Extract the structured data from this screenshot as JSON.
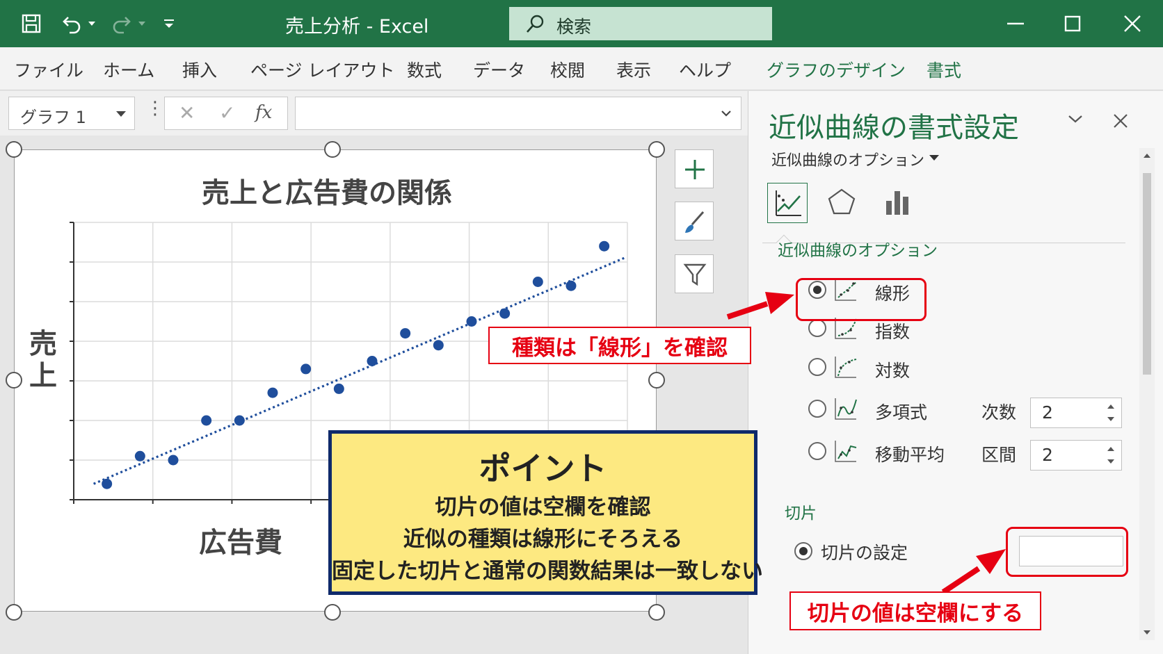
{
  "titlebar": {
    "title": "売上分析 - Excel",
    "search_label": "検索",
    "accent_color": "#217346"
  },
  "ribbon": {
    "tabs": [
      "ファイル",
      "ホーム",
      "挿入",
      "ページ レイアウト",
      "数式",
      "データ",
      "校閲",
      "表示",
      "ヘルプ",
      "グラフのデザイン",
      "書式"
    ]
  },
  "formula_bar": {
    "name_box": "グラフ 1",
    "fx_label": "fx",
    "cancel_symbol": "✕",
    "enter_symbol": "✓",
    "dots": "⋮"
  },
  "chart": {
    "title": "売上と広告費の関係",
    "ylabel_chars": [
      "売",
      "上"
    ],
    "xlabel": "広告費"
  },
  "chart_data": {
    "type": "scatter",
    "title": "売上と広告費の関係",
    "xlabel": "広告費",
    "ylabel": "売上",
    "x": [
      1,
      2,
      3,
      4,
      5,
      6,
      7,
      8,
      9,
      10,
      11,
      12,
      13,
      14,
      15,
      16
    ],
    "y": [
      0.4,
      1.1,
      1.0,
      2.0,
      2.0,
      2.7,
      3.3,
      2.8,
      3.5,
      4.2,
      3.9,
      4.5,
      4.7,
      5.5,
      5.4,
      6.4
    ],
    "trendline": {
      "type": "linear",
      "style": "dotted",
      "x": [
        0.6,
        16.6
      ],
      "y": [
        0.4,
        6.1
      ]
    },
    "xlim": [
      0,
      16.7
    ],
    "ylim": [
      0,
      7
    ],
    "grid": true,
    "marker_color": "#1f4e9c"
  },
  "pane": {
    "title": "近似曲線の書式設定",
    "subtitle": "近似曲線のオプション",
    "section_options": "近似曲線のオプション",
    "options": [
      {
        "label": "線形",
        "checked": true
      },
      {
        "label": "指数",
        "checked": false
      },
      {
        "label": "対数",
        "checked": false
      },
      {
        "label": "多項式",
        "checked": false
      },
      {
        "label": "移動平均",
        "checked": false
      }
    ],
    "order_label": "次数",
    "order_value": "2",
    "period_label": "区間",
    "period_value": "2",
    "section_intercept": "切片",
    "intercept_label": "切片の設定",
    "intercept_value": ""
  },
  "annotations": {
    "linear_callout": "種類は「線形」を確認",
    "intercept_callout": "切片の値は空欄にする",
    "callout_color": "#e60012",
    "point_title": "ポイント",
    "point_lines": [
      "切片の値は空欄を確認",
      "近似の種類は線形にそろえる",
      "固定した切片と通常の関数結果は一致しない"
    ]
  }
}
